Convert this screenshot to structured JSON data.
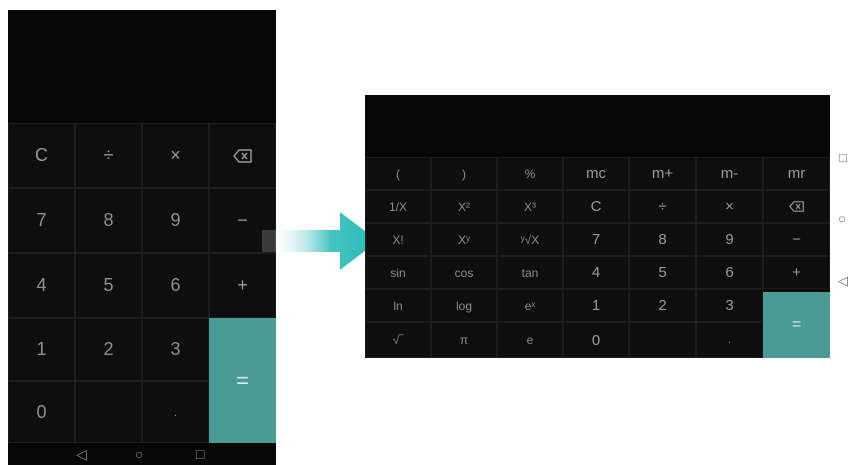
{
  "portrait": {
    "rows": [
      [
        "C",
        "÷",
        "×",
        "⌫"
      ],
      [
        "7",
        "8",
        "9",
        "−"
      ],
      [
        "4",
        "5",
        "6",
        "+"
      ],
      [
        "1",
        "2",
        "3",
        "="
      ],
      [
        "0",
        ".",
        "",
        ""
      ]
    ],
    "equals": "=",
    "nav": {
      "back": "◁",
      "home": "○",
      "recents": "□"
    }
  },
  "landscape": {
    "rows": [
      [
        "(",
        ")",
        "%",
        "mc",
        "m+",
        "m-",
        "mr"
      ],
      [
        "1/X",
        "X²",
        "X³",
        "C",
        "÷",
        "×",
        "⌫"
      ],
      [
        "X!",
        "Xʸ",
        "ʸ√X",
        "7",
        "8",
        "9",
        "−"
      ],
      [
        "sin",
        "cos",
        "tan",
        "4",
        "5",
        "6",
        "+"
      ],
      [
        "ln",
        "log",
        "eˣ",
        "1",
        "2",
        "3",
        "="
      ],
      [
        "√‾",
        "π",
        "e",
        "0",
        "",
        ".",
        ""
      ]
    ],
    "nav": {
      "recents": "□",
      "home": "○",
      "back": "◁"
    }
  },
  "colors": {
    "equals_accent": "#4a9a96",
    "arrow_accent": "#27b9b7",
    "background": "#0b0b0b"
  }
}
